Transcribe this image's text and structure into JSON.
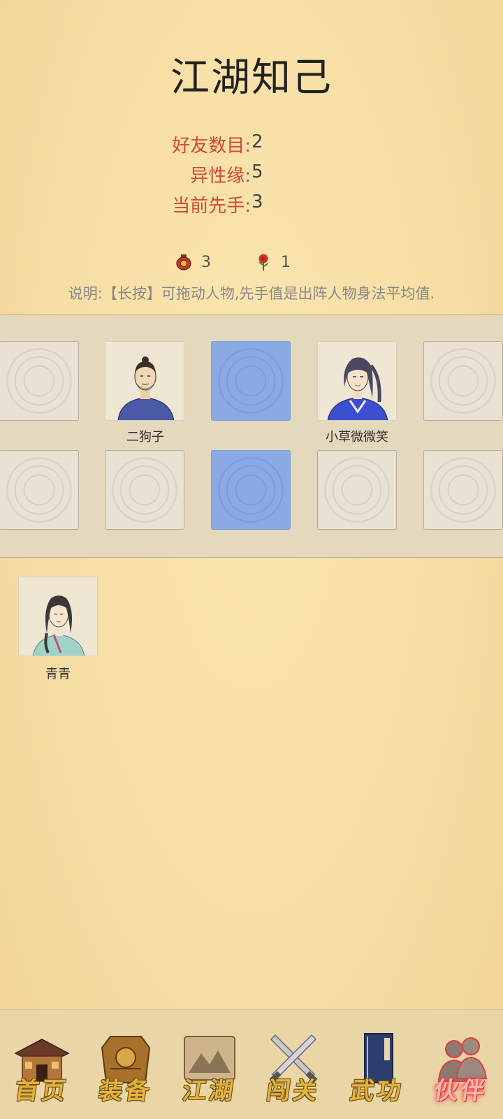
{
  "title": "江湖知己",
  "stats": [
    {
      "label": "好友数目:",
      "value": "2"
    },
    {
      "label": "异性缘:",
      "value": "5"
    },
    {
      "label": "当前先手:",
      "value": "3"
    }
  ],
  "items": [
    {
      "icon": "wine-jar-icon",
      "count": "3"
    },
    {
      "icon": "rose-icon",
      "count": "1"
    }
  ],
  "explanation": "说明:【长按】可拖动人物,先手值是出阵人物身法平均值.",
  "formation": {
    "row1": [
      {
        "type": "empty"
      },
      {
        "type": "character",
        "name": "二狗子"
      },
      {
        "type": "empty-blue"
      },
      {
        "type": "character",
        "name": "小草微微笑"
      },
      {
        "type": "empty"
      }
    ],
    "row2": [
      {
        "type": "empty"
      },
      {
        "type": "empty"
      },
      {
        "type": "empty-blue"
      },
      {
        "type": "empty"
      },
      {
        "type": "empty"
      }
    ]
  },
  "bench": [
    {
      "name": "青青"
    }
  ],
  "nav": [
    {
      "label": "首页",
      "icon": "house-icon"
    },
    {
      "label": "装备",
      "icon": "armor-icon"
    },
    {
      "label": "江湖",
      "icon": "scroll-map-icon"
    },
    {
      "label": "闯关",
      "icon": "crossed-swords-icon"
    },
    {
      "label": "武功",
      "icon": "book-icon"
    },
    {
      "label": "伙伴",
      "icon": "companions-icon",
      "active": true
    }
  ],
  "colors": {
    "stat_label": "#d0473a",
    "blue_slot": "#8aaae6",
    "nav_text": "#e2b23d",
    "nav_active_glow": "#ff4040"
  }
}
